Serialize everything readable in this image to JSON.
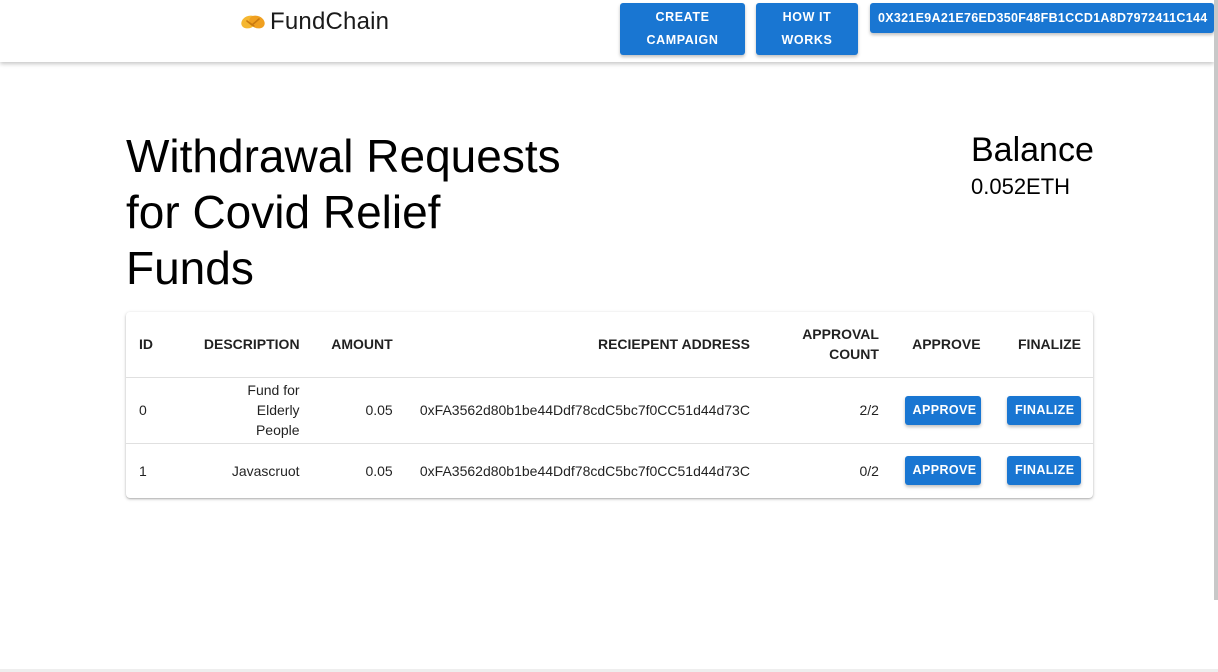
{
  "header": {
    "brand_icon": "handshake-icon",
    "brand_name": "FundChain",
    "create_campaign_label": "CREATE CAMPAIGN",
    "how_it_works_label": "HOW IT WORKS",
    "account_address": "0X321E9A21E76ED350F48FB1CCD1A8D7972411C144"
  },
  "main": {
    "title": "Withdrawal Requests for Covid Relief Funds",
    "balance_label": "Balance",
    "balance_value": "0.052ETH"
  },
  "table": {
    "headers": {
      "id": "ID",
      "description": "DESCRIPTION",
      "amount": "AMOUNT",
      "recipient": "RECIEPENT ADDRESS",
      "approval_count": "APPROVAL COUNT",
      "approve": "APPROVE",
      "finalize": "FINALIZE"
    },
    "rows": [
      {
        "id": "0",
        "description": "Fund for Elderly People",
        "amount": "0.05",
        "recipient": "0xFA3562d80b1be44Ddf78cdC5bc7f0CC51d44d73C",
        "approval_count": "2/2",
        "approve_label": "APPROVE",
        "finalize_label": "FINALIZE"
      },
      {
        "id": "1",
        "description": "Javascruot",
        "amount": "0.05",
        "recipient": "0xFA3562d80b1be44Ddf78cdC5bc7f0CC51d44d73C",
        "approval_count": "0/2",
        "approve_label": "APPROVE",
        "finalize_label": "FINALIZE"
      }
    ]
  },
  "colors": {
    "primary": "#1976d2",
    "brand_icon": "#f5b731"
  }
}
